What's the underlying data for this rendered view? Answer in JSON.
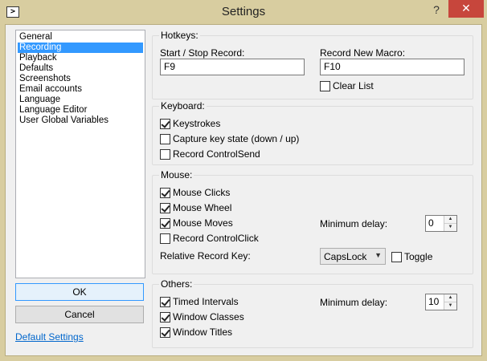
{
  "window": {
    "title": "Settings",
    "app_icon": "terminal-prompt-icon",
    "help": "?",
    "close": "✕"
  },
  "nav": {
    "items": [
      "General",
      "Recording",
      "Playback",
      "Defaults",
      "Screenshots",
      "Email accounts",
      "Language",
      "Language Editor",
      "User Global Variables"
    ],
    "selected_index": 1
  },
  "buttons": {
    "ok": "OK",
    "cancel": "Cancel"
  },
  "default_settings_link": "Default Settings",
  "hotkeys": {
    "title": "Hotkeys:",
    "start_stop_label": "Start / Stop Record:",
    "start_stop_value": "F9",
    "new_macro_label": "Record New Macro:",
    "new_macro_value": "F10",
    "clear_list": {
      "label": "Clear List",
      "checked": false
    }
  },
  "keyboard": {
    "title": "Keyboard:",
    "keystrokes": {
      "label": "Keystrokes",
      "checked": true
    },
    "capture_state": {
      "label": "Capture key state (down / up)",
      "checked": false
    },
    "control_send": {
      "label": "Record ControlSend",
      "checked": false
    }
  },
  "mouse": {
    "title": "Mouse:",
    "clicks": {
      "label": "Mouse Clicks",
      "checked": true
    },
    "wheel": {
      "label": "Mouse Wheel",
      "checked": true
    },
    "moves": {
      "label": "Mouse Moves",
      "checked": true
    },
    "control_click": {
      "label": "Record ControlClick",
      "checked": false
    },
    "min_delay_label": "Minimum delay:",
    "min_delay_value": "0",
    "relative_key_label": "Relative Record Key:",
    "relative_key_value": "CapsLock",
    "toggle": {
      "label": "Toggle",
      "checked": false
    }
  },
  "others": {
    "title": "Others:",
    "timed_intervals": {
      "label": "Timed Intervals",
      "checked": true
    },
    "window_classes": {
      "label": "Window Classes",
      "checked": true
    },
    "window_titles": {
      "label": "Window Titles",
      "checked": true
    },
    "min_delay_label": "Minimum delay:",
    "min_delay_value": "10"
  }
}
